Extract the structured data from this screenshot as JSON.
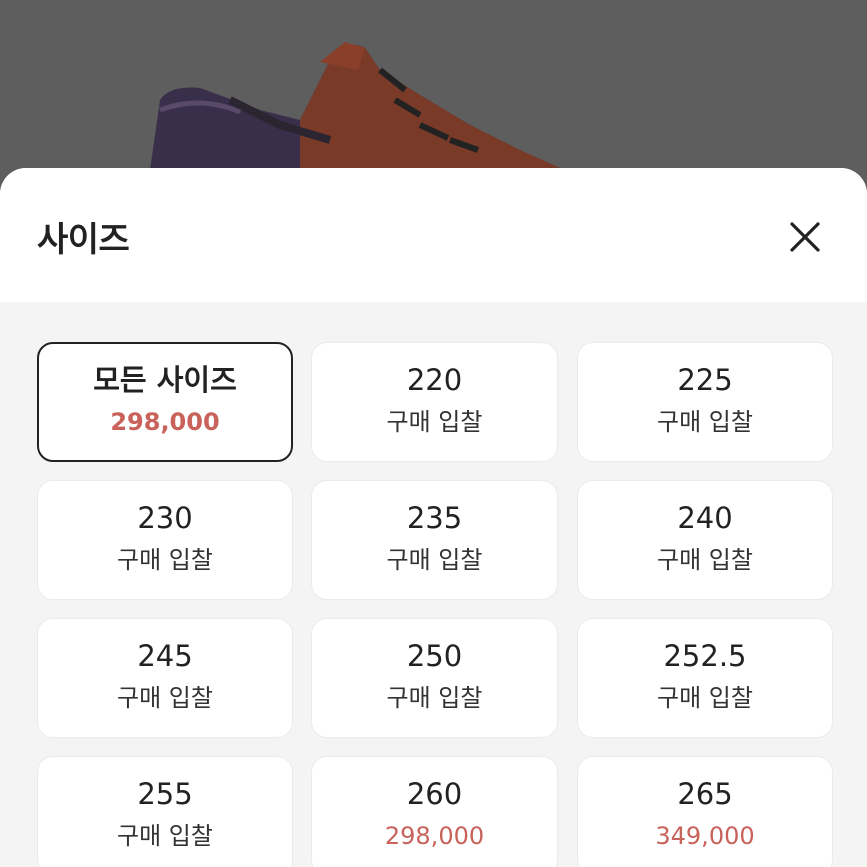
{
  "sheet": {
    "title": "사이즈"
  },
  "colors": {
    "price_accent": "#c8625a",
    "selected_border": "#222222"
  },
  "sizes": [
    {
      "size": "모든 사이즈",
      "price": "298,000",
      "selected": true
    },
    {
      "size": "220",
      "price": "구매 입찰"
    },
    {
      "size": "225",
      "price": "구매 입찰"
    },
    {
      "size": "230",
      "price": "구매 입찰"
    },
    {
      "size": "235",
      "price": "구매 입찰"
    },
    {
      "size": "240",
      "price": "구매 입찰"
    },
    {
      "size": "245",
      "price": "구매 입찰"
    },
    {
      "size": "250",
      "price": "구매 입찰"
    },
    {
      "size": "252.5",
      "price": "구매 입찰"
    },
    {
      "size": "255",
      "price": "구매 입찰"
    },
    {
      "size": "260",
      "price": "298,000",
      "has_price": true
    },
    {
      "size": "265",
      "price": "349,000",
      "has_price": true
    }
  ]
}
